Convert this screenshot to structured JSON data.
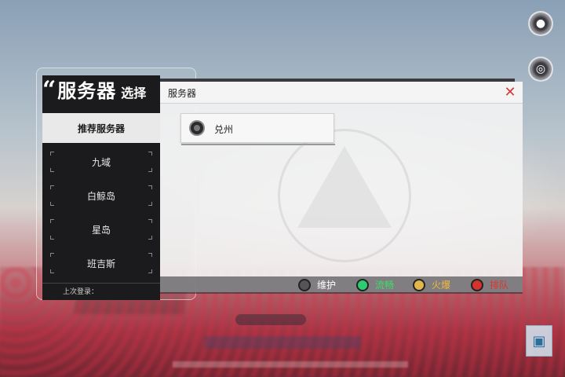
{
  "header": {
    "quote": "“",
    "title": "服务器",
    "subtitle": "选择"
  },
  "sidebar": {
    "items": [
      {
        "label": "推荐服务器",
        "active": true
      },
      {
        "label": "九域",
        "active": false
      },
      {
        "label": "白鲸岛",
        "active": false
      },
      {
        "label": "星岛",
        "active": false
      },
      {
        "label": "班吉斯",
        "active": false
      }
    ],
    "last_login_label": "上次登录："
  },
  "panel": {
    "title": "服务器",
    "close_icon": "close-icon",
    "servers": [
      {
        "name": "兑州",
        "status": "maintenance"
      }
    ]
  },
  "legend": [
    {
      "label": "维护",
      "dot_color": "#444444",
      "text_color": "#ffffff"
    },
    {
      "label": "流畅",
      "dot_color": "#2ecc71",
      "text_color": "#3ddc6a"
    },
    {
      "label": "火爆",
      "dot_color": "#e2b64a",
      "text_color": "#f0b93c"
    },
    {
      "label": "排队",
      "dot_color": "#d6332b",
      "text_color": "#e0342c"
    }
  ],
  "colors": {
    "accent_close": "#d23b3b",
    "panel_dark": "#1b1b1d"
  }
}
